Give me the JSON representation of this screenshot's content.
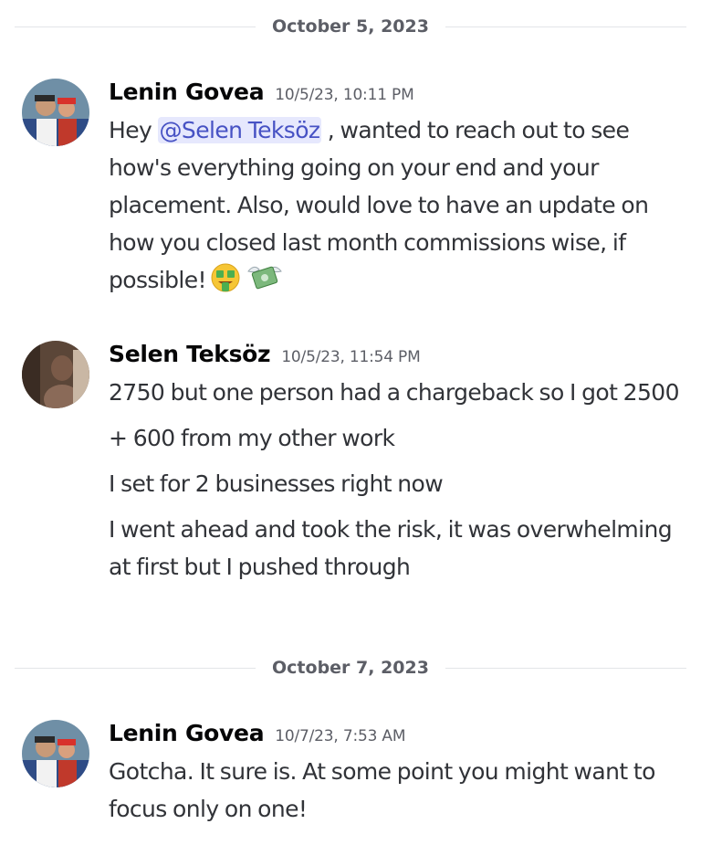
{
  "dividers": [
    {
      "date": "October 5, 2023"
    },
    {
      "date": "October 7, 2023"
    }
  ],
  "messages": [
    {
      "author": "Lenin Govea",
      "timestamp": "10/5/23, 10:11 PM",
      "text_before": "Hey ",
      "mention": "@Selen Teksöz",
      "text_after": " , wanted to reach out to see how's everything going on your end and your placement. Also, would love to have an update on how you closed last month commissions wise, if possible!",
      "emojis": [
        "money-mouth-face-emoji",
        "money-with-wings-emoji"
      ]
    },
    {
      "author": "Selen Teksöz",
      "timestamp": "10/5/23, 11:54 PM",
      "lines": [
        "2750 but one person had a chargeback so I got 2500",
        "+ 600 from my other work",
        "I set for 2 businesses right now",
        "I went ahead and took the risk, it was overwhelming at first but I pushed through"
      ]
    },
    {
      "author": "Lenin Govea",
      "timestamp": "10/7/23, 7:53 AM",
      "lines": [
        "Gotcha. It sure is. At some point you might want to focus only on one!"
      ]
    }
  ],
  "colors": {
    "mention_bg": "#e6e8fd",
    "mention_text": "#4752c4",
    "timestamp": "#5c5e66",
    "body_text": "#313338"
  }
}
